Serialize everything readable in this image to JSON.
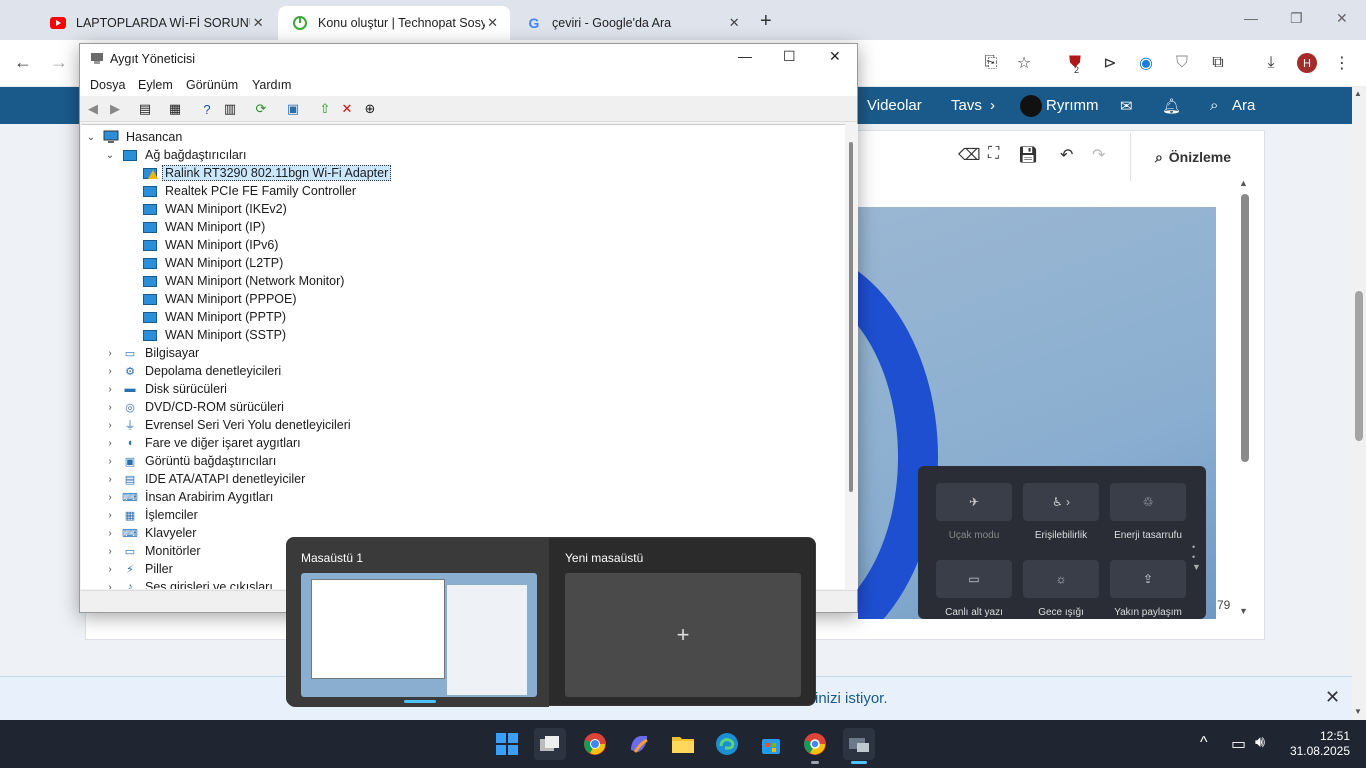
{
  "browser": {
    "tabs": [
      {
        "title": "LAPTOPLARDA Wİ-Fİ SORUNU",
        "icon": "youtube-icon",
        "active": false
      },
      {
        "title": "Konu oluştur | Technopat Sosya",
        "icon": "technopat-icon",
        "active": true
      },
      {
        "title": "çeviri - Google'da Ara",
        "icon": "google-icon",
        "active": false
      }
    ],
    "extension_badge": "2"
  },
  "site": {
    "nav": {
      "videolar": "Videolar",
      "tavs": "Tavs",
      "user": "Ryrımm",
      "search": "Ara"
    },
    "editor": {
      "preview": "Önizleme"
    },
    "page_number": "79",
    "notification": "inizi istiyor."
  },
  "quick_settings": [
    {
      "label": "Uçak modu",
      "icon": "airplane-icon"
    },
    {
      "label": "Erişilebilirlik",
      "icon": "accessibility-icon"
    },
    {
      "label": "Enerji tasarrufu",
      "icon": "energy-saver-icon"
    },
    {
      "label": "Canlı alt yazı",
      "icon": "live-caption-icon"
    },
    {
      "label": "Gece ışığı",
      "icon": "night-light-icon"
    },
    {
      "label": "Yakın paylaşım",
      "icon": "nearby-share-icon"
    }
  ],
  "device_manager": {
    "title": "Aygıt Yöneticisi",
    "menu": [
      "Dosya",
      "Eylem",
      "Görünüm",
      "Yardım"
    ],
    "root": "Hasancan",
    "network_category": "Ağ bağdaştırıcıları",
    "network_devices": [
      "Ralink RT3290 802.11bgn Wi-Fi Adapter",
      "Realtek PCIe FE Family Controller",
      "WAN Miniport (IKEv2)",
      "WAN Miniport (IP)",
      "WAN Miniport (IPv6)",
      "WAN Miniport (L2TP)",
      "WAN Miniport (Network Monitor)",
      "WAN Miniport (PPPOE)",
      "WAN Miniport (PPTP)",
      "WAN Miniport (SSTP)"
    ],
    "categories": [
      "Bilgisayar",
      "Depolama denetleyicileri",
      "Disk sürücüleri",
      "DVD/CD-ROM sürücüleri",
      "Evrensel Seri Veri Yolu denetleyicileri",
      "Fare ve diğer işaret aygıtları",
      "Görüntü bağdaştırıcıları",
      "IDE ATA/ATAPI denetleyiciler",
      "İnsan Arabirim Aygıtları",
      "İşlemciler",
      "Klavyeler",
      "Monitörler",
      "Piller",
      "Ses girişleri ve çıkışları"
    ]
  },
  "task_view": {
    "desktop1": "Masaüstü 1",
    "new_desktop": "Yeni masaüstü",
    "add_symbol": "+"
  },
  "taskbar": {
    "time": "12:51",
    "date": "31.08.2025"
  }
}
